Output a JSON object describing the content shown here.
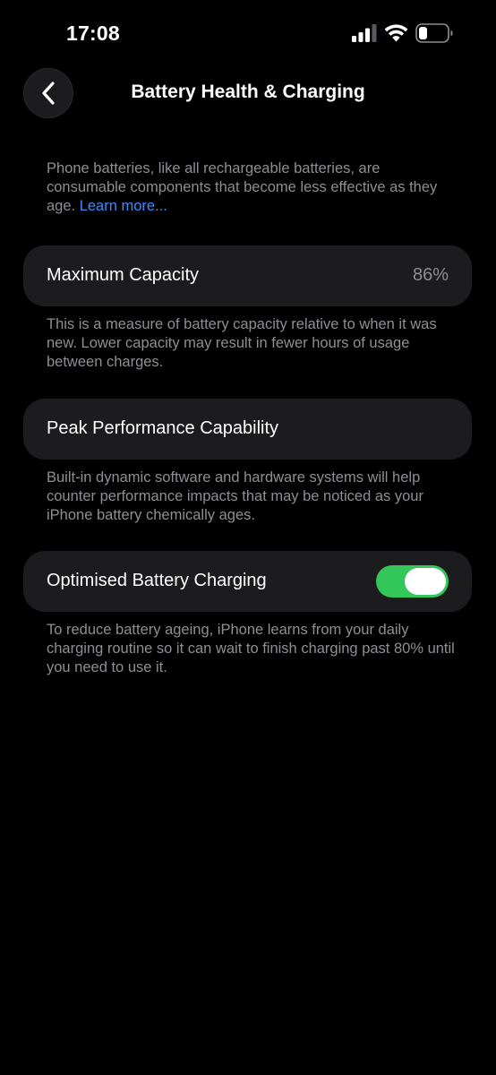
{
  "status_bar": {
    "time": "17:08",
    "icons": [
      "signal-icon",
      "wifi-icon",
      "battery-icon"
    ],
    "battery_level_fraction": 0.3
  },
  "nav": {
    "back_icon": "chevron-left-icon",
    "title": "Battery Health & Charging"
  },
  "intro": {
    "text": "Phone batteries, like all rechargeable batteries, are consumable components that become less effective as they age. ",
    "link": "Learn more..."
  },
  "maximum_capacity": {
    "label": "Maximum Capacity",
    "value": "86%",
    "description": "This is a measure of battery capacity relative to when it was new. Lower capacity may result in fewer hours of usage between charges."
  },
  "peak_performance": {
    "label": "Peak Performance Capability",
    "description": "Built-in dynamic software and hardware systems will help counter performance impacts that may be noticed as your iPhone battery chemically ages."
  },
  "optimised_charging": {
    "label": "Optimised Battery Charging",
    "enabled": true,
    "description": "To reduce battery ageing, iPhone learns from your daily charging routine so it can wait to finish charging past 80% until you need to use it."
  },
  "colors": {
    "background": "#000000",
    "card": "#1c1c1e",
    "secondary_text": "#8e8e93",
    "link": "#3e8bff",
    "toggle_on": "#33c759"
  }
}
